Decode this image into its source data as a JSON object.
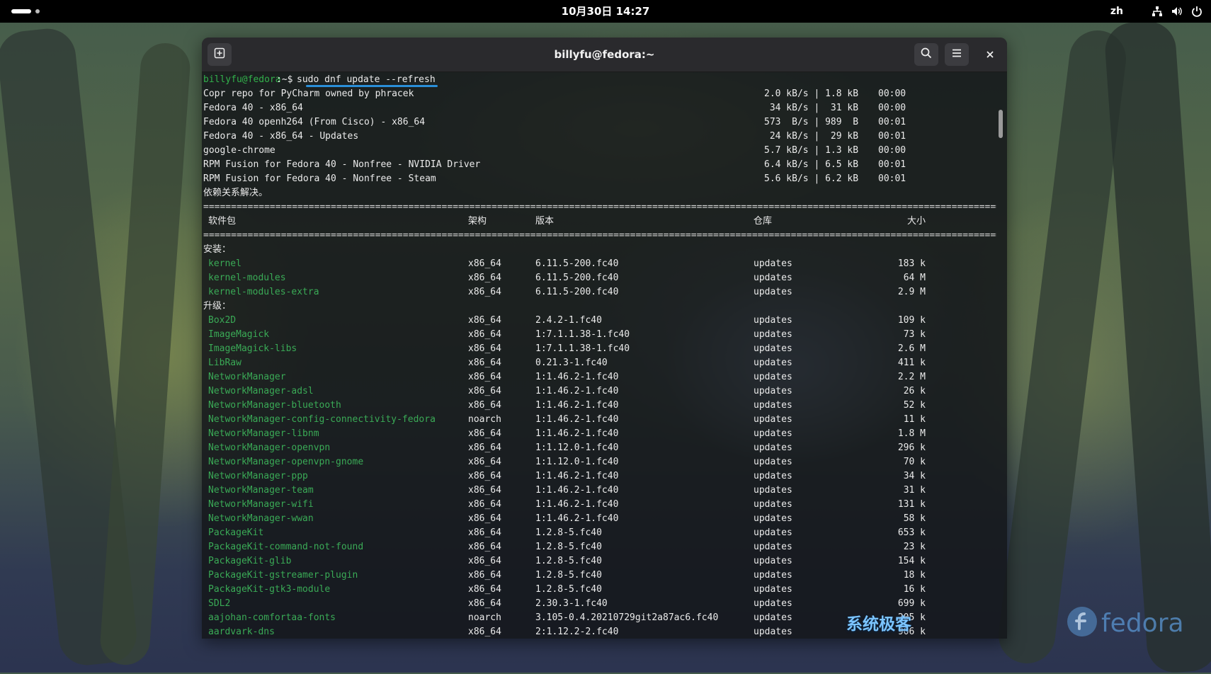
{
  "topbar": {
    "clock": "10月30日 14:27",
    "language": "zh",
    "tray_icons": [
      "network-icon",
      "volume-icon",
      "power-icon"
    ]
  },
  "window": {
    "title": "billyfu@fedora:~",
    "buttons": [
      "new-tab-icon",
      "search-icon",
      "hamburger-menu-icon",
      "close-icon"
    ]
  },
  "terminal": {
    "prompt_user": "billyfu@fedora",
    "prompt_sep": ":~$",
    "command": "sudo dnf update --refresh",
    "repos": [
      {
        "name": "Copr repo for PyCharm owned by phracek",
        "rate": "2.0 kB/s | 1.8 kB",
        "time": "00:00"
      },
      {
        "name": "Fedora 40 - x86_64",
        "rate": " 34 kB/s |  31 kB",
        "time": "00:00"
      },
      {
        "name": "Fedora 40 openh264 (From Cisco) - x86_64",
        "rate": "573  B/s | 989  B",
        "time": "00:01"
      },
      {
        "name": "Fedora 40 - x86_64 - Updates",
        "rate": " 24 kB/s |  29 kB",
        "time": "00:01"
      },
      {
        "name": "google-chrome",
        "rate": "5.7 kB/s | 1.3 kB",
        "time": "00:00"
      },
      {
        "name": "RPM Fusion for Fedora 40 - Nonfree - NVIDIA Driver",
        "rate": "6.4 kB/s | 6.5 kB",
        "time": "00:01"
      },
      {
        "name": "RPM Fusion for Fedora 40 - Nonfree - Steam",
        "rate": "5.6 kB/s | 6.2 kB",
        "time": "00:01"
      }
    ],
    "resolved": "依赖关系解决。",
    "rule": "================================================================================================================================================================",
    "headers": {
      "package": "软件包",
      "arch": "架构",
      "version": "版本",
      "repo": "仓库",
      "size": "大小"
    },
    "install_label": "安装：",
    "install": [
      {
        "name": "kernel",
        "arch": "x86_64",
        "version": "6.11.5-200.fc40",
        "repo": "updates",
        "size": "183 k"
      },
      {
        "name": "kernel-modules",
        "arch": "x86_64",
        "version": "6.11.5-200.fc40",
        "repo": "updates",
        "size": "64 M"
      },
      {
        "name": "kernel-modules-extra",
        "arch": "x86_64",
        "version": "6.11.5-200.fc40",
        "repo": "updates",
        "size": "2.9 M"
      }
    ],
    "upgrade_label": "升级：",
    "upgrade": [
      {
        "name": "Box2D",
        "arch": "x86_64",
        "version": "2.4.2-1.fc40",
        "repo": "updates",
        "size": "109 k"
      },
      {
        "name": "ImageMagick",
        "arch": "x86_64",
        "version": "1:7.1.1.38-1.fc40",
        "repo": "updates",
        "size": "73 k"
      },
      {
        "name": "ImageMagick-libs",
        "arch": "x86_64",
        "version": "1:7.1.1.38-1.fc40",
        "repo": "updates",
        "size": "2.6 M"
      },
      {
        "name": "LibRaw",
        "arch": "x86_64",
        "version": "0.21.3-1.fc40",
        "repo": "updates",
        "size": "411 k"
      },
      {
        "name": "NetworkManager",
        "arch": "x86_64",
        "version": "1:1.46.2-1.fc40",
        "repo": "updates",
        "size": "2.2 M"
      },
      {
        "name": "NetworkManager-adsl",
        "arch": "x86_64",
        "version": "1:1.46.2-1.fc40",
        "repo": "updates",
        "size": "26 k"
      },
      {
        "name": "NetworkManager-bluetooth",
        "arch": "x86_64",
        "version": "1:1.46.2-1.fc40",
        "repo": "updates",
        "size": "52 k"
      },
      {
        "name": "NetworkManager-config-connectivity-fedora",
        "arch": "noarch",
        "version": "1:1.46.2-1.fc40",
        "repo": "updates",
        "size": "11 k"
      },
      {
        "name": "NetworkManager-libnm",
        "arch": "x86_64",
        "version": "1:1.46.2-1.fc40",
        "repo": "updates",
        "size": "1.8 M"
      },
      {
        "name": "NetworkManager-openvpn",
        "arch": "x86_64",
        "version": "1:1.12.0-1.fc40",
        "repo": "updates",
        "size": "296 k"
      },
      {
        "name": "NetworkManager-openvpn-gnome",
        "arch": "x86_64",
        "version": "1:1.12.0-1.fc40",
        "repo": "updates",
        "size": "70 k"
      },
      {
        "name": "NetworkManager-ppp",
        "arch": "x86_64",
        "version": "1:1.46.2-1.fc40",
        "repo": "updates",
        "size": "34 k"
      },
      {
        "name": "NetworkManager-team",
        "arch": "x86_64",
        "version": "1:1.46.2-1.fc40",
        "repo": "updates",
        "size": "31 k"
      },
      {
        "name": "NetworkManager-wifi",
        "arch": "x86_64",
        "version": "1:1.46.2-1.fc40",
        "repo": "updates",
        "size": "131 k"
      },
      {
        "name": "NetworkManager-wwan",
        "arch": "x86_64",
        "version": "1:1.46.2-1.fc40",
        "repo": "updates",
        "size": "58 k"
      },
      {
        "name": "PackageKit",
        "arch": "x86_64",
        "version": "1.2.8-5.fc40",
        "repo": "updates",
        "size": "653 k"
      },
      {
        "name": "PackageKit-command-not-found",
        "arch": "x86_64",
        "version": "1.2.8-5.fc40",
        "repo": "updates",
        "size": "23 k"
      },
      {
        "name": "PackageKit-glib",
        "arch": "x86_64",
        "version": "1.2.8-5.fc40",
        "repo": "updates",
        "size": "154 k"
      },
      {
        "name": "PackageKit-gstreamer-plugin",
        "arch": "x86_64",
        "version": "1.2.8-5.fc40",
        "repo": "updates",
        "size": "18 k"
      },
      {
        "name": "PackageKit-gtk3-module",
        "arch": "x86_64",
        "version": "1.2.8-5.fc40",
        "repo": "updates",
        "size": "16 k"
      },
      {
        "name": "SDL2",
        "arch": "x86_64",
        "version": "2.30.3-1.fc40",
        "repo": "updates",
        "size": "699 k"
      },
      {
        "name": "aajohan-comfortaa-fonts",
        "arch": "noarch",
        "version": "3.105-0.4.20210729git2a87ac6.fc40",
        "repo": "updates",
        "size": "205 k"
      },
      {
        "name": "aardvark-dns",
        "arch": "x86_64",
        "version": "2:1.12.2-2.fc40",
        "repo": "updates",
        "size": "906 k"
      }
    ]
  },
  "watermark": "系统极客",
  "desktop_logo": "fedora",
  "colors": {
    "prompt": "#32b14b",
    "package": "#3aaa56",
    "underline": "#2a8fd8"
  }
}
